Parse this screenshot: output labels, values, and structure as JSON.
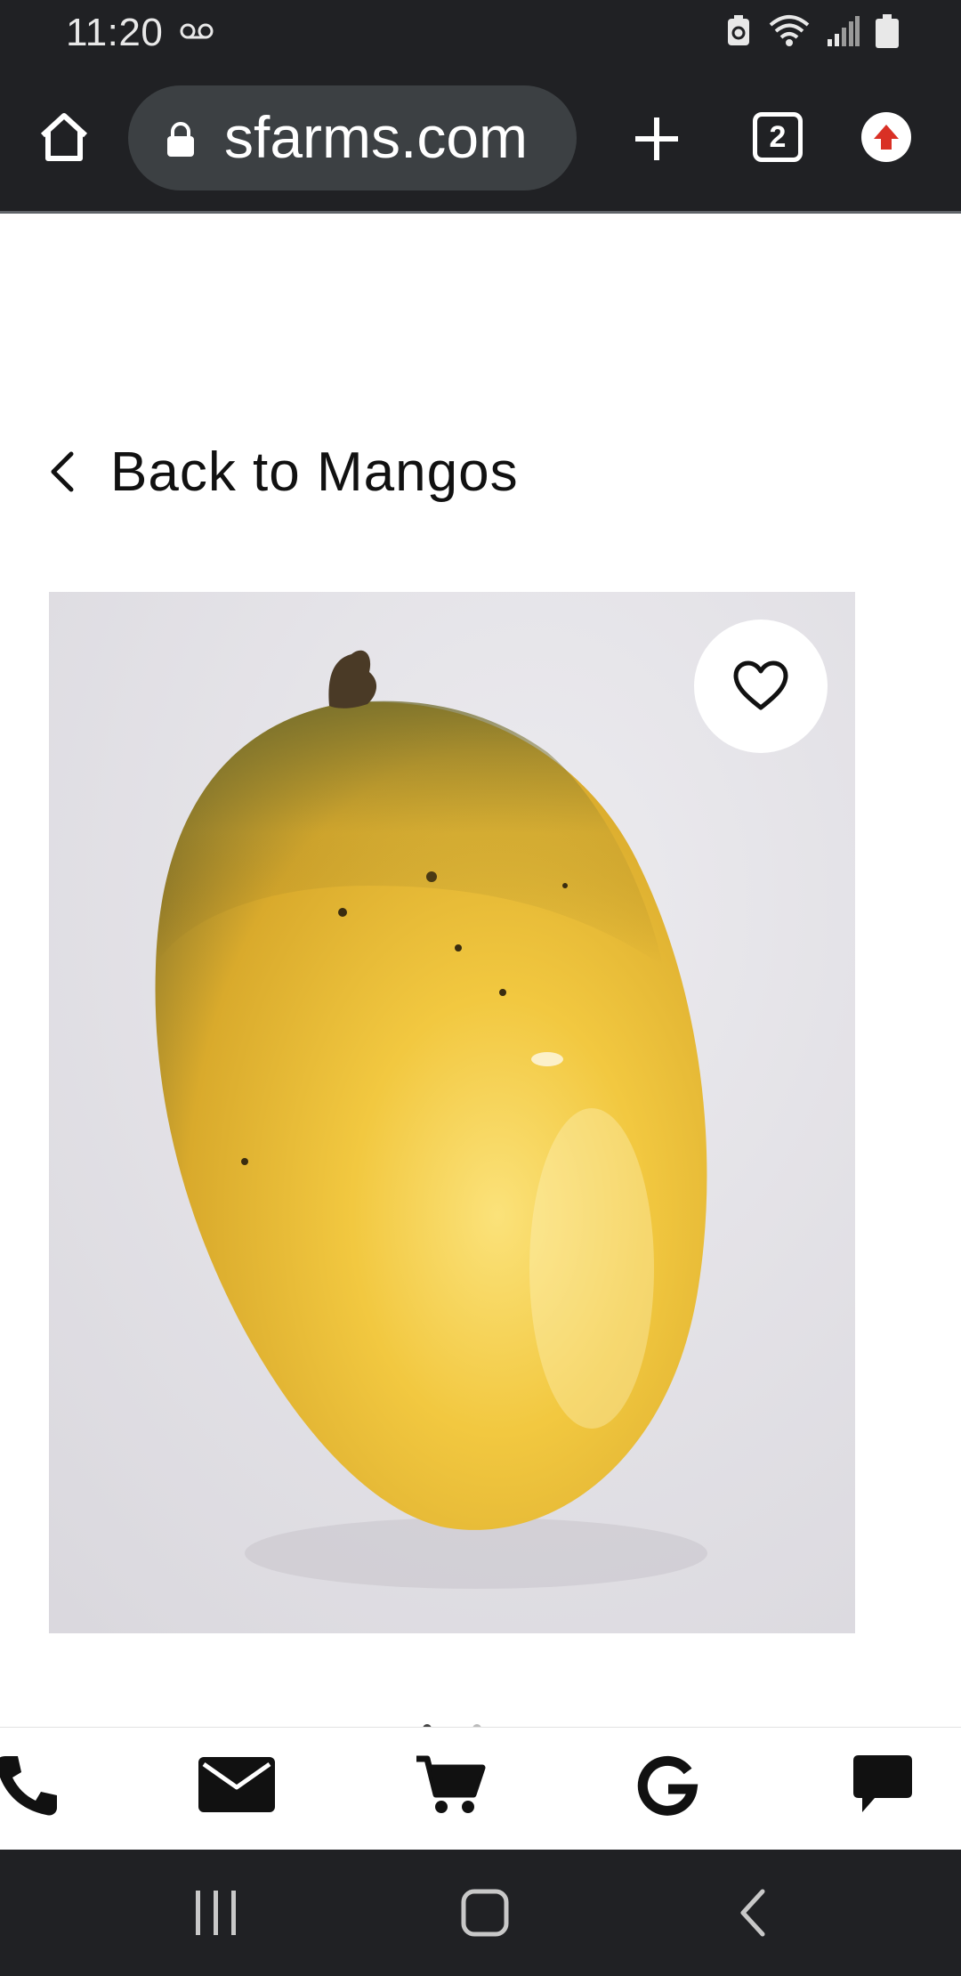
{
  "status_bar": {
    "time": "11:20",
    "icons": [
      "voicemail-icon",
      "battery-saver-icon",
      "wifi-icon",
      "signal-icon",
      "battery-icon"
    ]
  },
  "browser": {
    "url": "sfarms.com",
    "tab_count": "2",
    "icons": [
      "home-icon",
      "lock-icon",
      "plus-icon",
      "tabs-icon",
      "update-icon"
    ]
  },
  "page": {
    "back_link": "Back to Mangos",
    "product_image_alt": "mango",
    "icons": [
      "chevron-left-icon",
      "heart-icon"
    ]
  },
  "action_bar": {
    "items": [
      "phone-icon",
      "mail-icon",
      "cart-icon",
      "google-icon",
      "chat-icon"
    ]
  },
  "nav_bar": {
    "items": [
      "recent-apps-icon",
      "home-icon",
      "back-icon"
    ]
  },
  "colors": {
    "chrome_dark": "#202124",
    "url_pill": "#3c4043",
    "update_red": "#d93025",
    "mango_yellow": "#f0c030"
  }
}
